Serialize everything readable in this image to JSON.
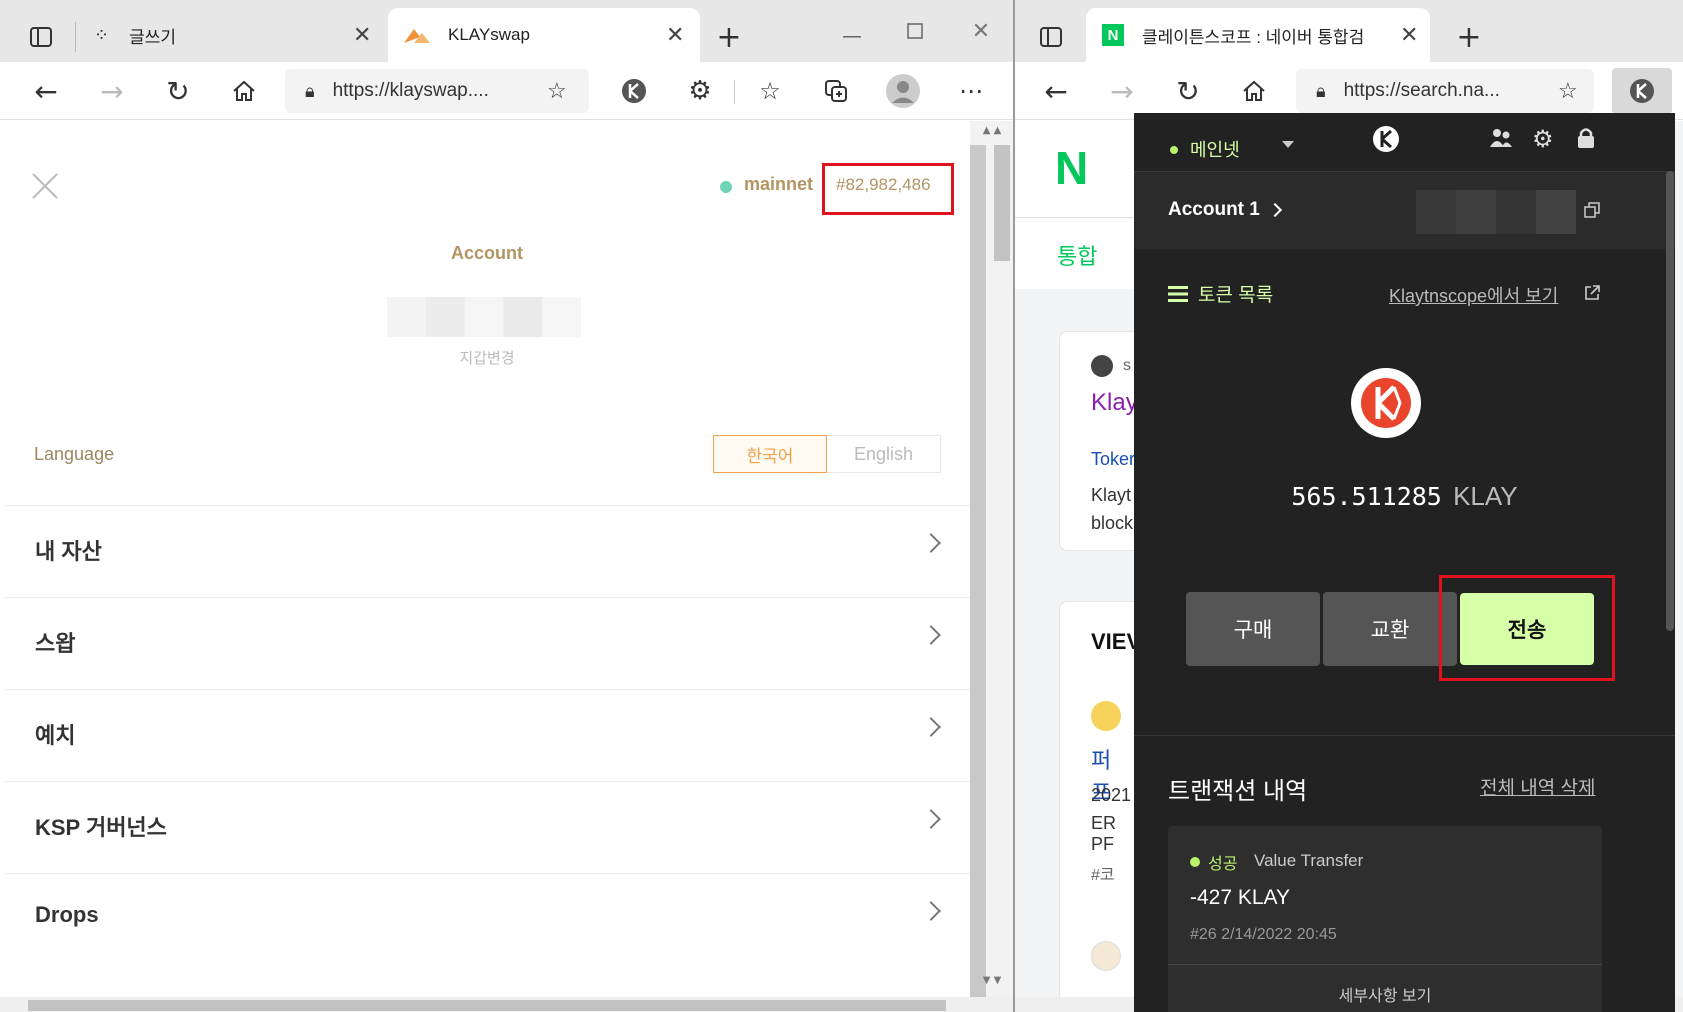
{
  "left_browser": {
    "tabs": [
      {
        "label": "글쓰기"
      },
      {
        "label": "KLAYswap"
      }
    ],
    "url": "https://klayswap...."
  },
  "right_browser": {
    "tabs": [
      {
        "label": "클레이튼스코프 : 네이버 통합검"
      }
    ],
    "url": "https://search.na..."
  },
  "klayswap": {
    "network": "mainnet",
    "block": "#82,982,486",
    "account_title": "Account",
    "change_wallet": "지갑변경",
    "language_label": "Language",
    "lang_korean": "한국어",
    "lang_english": "English",
    "menu": [
      {
        "label": "내 자산"
      },
      {
        "label": "스왑"
      },
      {
        "label": "예치"
      },
      {
        "label": "KSP 거버넌스"
      },
      {
        "label": "Drops"
      }
    ]
  },
  "naver_bg": {
    "logo": "N",
    "tab": "통합",
    "snippet_1": "s",
    "snippet_2": "Klay",
    "snippet_3": "Toker",
    "snippet_4": "Klayt",
    "snippet_5": "block",
    "view_title": "VIEV",
    "snippet_6": "퍼 프",
    "snippet_7": "2021",
    "snippet_8": "ER PF",
    "snippet_9": "#코"
  },
  "kaikas": {
    "network": "메인넷",
    "account": "Account 1",
    "token_list": "토큰 목록",
    "scope_link": "Klaytnscope에서 보기",
    "balance": "565.511285",
    "unit": "KLAY",
    "buy": "구매",
    "swap": "교환",
    "send": "전송",
    "tx_title": "트랜잭션 내역",
    "tx_clear": "전체 내역 삭제",
    "tx_status": "성공",
    "tx_type": "Value Transfer",
    "tx_amount": "-427 KLAY",
    "tx_meta": "#26 2/14/2022 20:45",
    "tx_more": "세부사항 보기"
  },
  "colors": {
    "accent_green": "#d6ffa8",
    "status_green": "#b9f26b",
    "klayswap_gold": "#b39464",
    "korean_btn_orange": "#f0a04b",
    "highlight_red": "#e0121c"
  }
}
